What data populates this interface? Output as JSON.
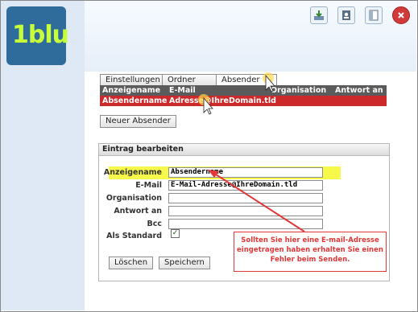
{
  "app": {
    "logo_text": "1blu"
  },
  "toolbar": {
    "icons": [
      "download-icon",
      "contacts-icon",
      "window-icon",
      "close-icon"
    ]
  },
  "tabs": [
    {
      "label": "Einstellungen"
    },
    {
      "label": "Ordner"
    },
    {
      "label": "Absender"
    }
  ],
  "table": {
    "headers": [
      "Anzeigename",
      "E-Mail",
      "Organisation",
      "Antwort an"
    ],
    "rows": [
      {
        "name": "Absendername",
        "email": "Adresse@IhreDomain.tld"
      }
    ]
  },
  "buttons": {
    "new_sender": "Neuer Absender",
    "delete": "Löschen",
    "save": "Speichern"
  },
  "edit": {
    "title": "Eintrag bearbeiten",
    "fields": [
      {
        "label": "Anzeigename",
        "value": "Absendername"
      },
      {
        "label": "E-Mail",
        "value": "E-Mail-Adresse@IhreDomain.tld"
      },
      {
        "label": "Organisation",
        "value": ""
      },
      {
        "label": "Antwort an",
        "value": ""
      },
      {
        "label": "Bcc",
        "value": ""
      }
    ],
    "default_label": "Als Standard",
    "default_checked": true
  },
  "annotation": {
    "text": "Sollten Sie hier eine E-mail-Adresse eingetragen haben erhalten Sie einen Fehler beim Senden."
  },
  "colors": {
    "highlight": "#f6f84a",
    "annotation": "#e03838",
    "selected_row": "#cc2a2a"
  }
}
